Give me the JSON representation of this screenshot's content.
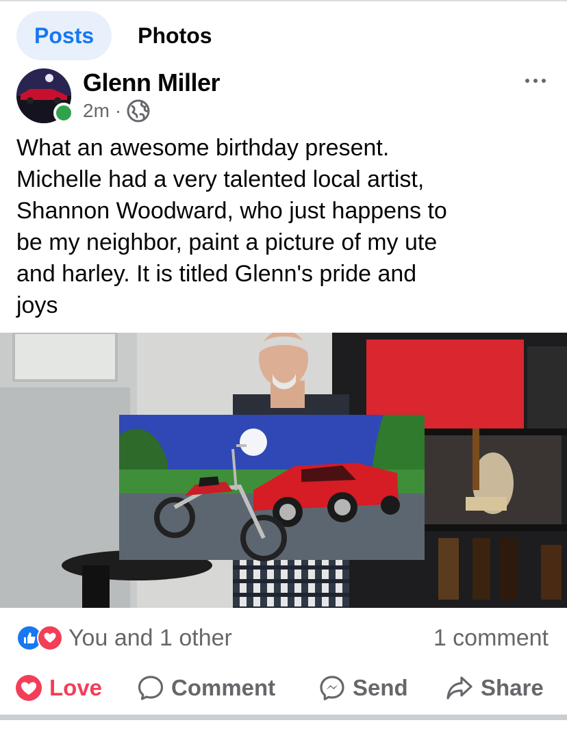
{
  "tabs": {
    "posts": "Posts",
    "photos": "Photos"
  },
  "post": {
    "author": "Glenn Miller",
    "time": "2m",
    "separator": "·",
    "privacy_icon": "globe-icon",
    "text": "What an awesome birthday present.\nMichelle had a very talented local artist,\nShannon Woodward,  who just happens to\nbe my neighbor, paint a picture of my ute\nand harley.  It is titled Glenn's pride and\njoys",
    "online": true
  },
  "reactions": {
    "icons": [
      "like-icon",
      "love-icon"
    ],
    "summary": "You and 1 other"
  },
  "comments": {
    "count_label": "1 comment"
  },
  "actions": {
    "love": "Love",
    "comment": "Comment",
    "send": "Send",
    "share": "Share"
  },
  "colors": {
    "accent": "#1877f2",
    "love": "#f33e58",
    "online": "#31a24c",
    "muted": "#65676b"
  }
}
